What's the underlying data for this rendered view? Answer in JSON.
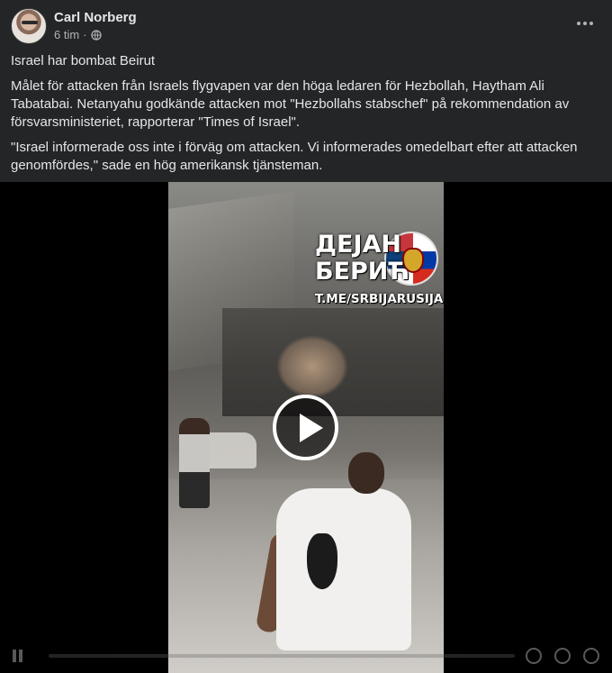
{
  "post": {
    "author": "Carl Norberg",
    "timestamp": "6 tim",
    "separator": "·",
    "privacy_icon": "globe-icon",
    "more_icon": "more-horizontal-icon",
    "paragraphs": [
      "Israel har bombat Beirut",
      "Målet för attacken från Israels flygvapen var den höga ledaren för Hezbollah, Haytham Ali Tabatabai. Netanyahu godkände attacken mot \"Hezbollahs stabschef\" på rekommendation av försvarsministeriet, rapporterar \"Times of Israel\".",
      "\"Israel informerade oss inte i förväg om attacken. Vi informerades omedelbart efter att attacken genomfördes,\" sade en hög amerikansk tjänsteman."
    ]
  },
  "video": {
    "watermark": {
      "line1": "ДЕЈАН",
      "line2": "БЕРИЋ",
      "url": "T.ME/SRBIJARUSIJA"
    },
    "play_icon": "play-icon"
  },
  "colors": {
    "background": "#242526",
    "text_primary": "#e4e6eb",
    "text_secondary": "#b0b3b8",
    "video_bg": "#000000"
  }
}
